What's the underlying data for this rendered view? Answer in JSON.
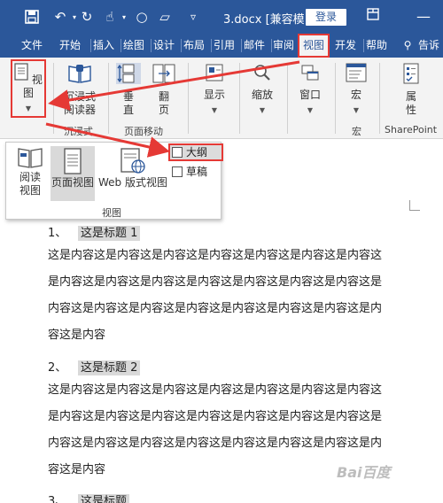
{
  "titlebar": {
    "doc_title": "3.docx [兼容模...",
    "login": "登录"
  },
  "tabs": [
    "文件",
    "开始",
    "插入",
    "绘图",
    "设计",
    "布局",
    "引用",
    "邮件",
    "审阅",
    "视图",
    "开发",
    "帮助",
    "告诉"
  ],
  "ribbon": {
    "view_btn": "视图",
    "immersive_btn_line1": "沉浸式",
    "immersive_btn_line2": "阅读器",
    "immersive_group": "沉浸式",
    "vertical_btn": "垂直",
    "flip_btn": "翻页",
    "page_move_group": "页面移动",
    "show_btn": "显示",
    "zoom_btn": "缩放",
    "window_btn": "窗口",
    "macro_btn": "宏",
    "macro_group": "宏",
    "props_btn": "属性",
    "sharepoint_group": "SharePoint"
  },
  "panel": {
    "read_line1": "阅读",
    "read_line2": "视图",
    "page_view": "页面视图",
    "web_view": "Web 版式视图",
    "label": "视图",
    "outline": "大纲",
    "draft": "草稿"
  },
  "document": {
    "h1_num": "1、",
    "h1_text": "这是标题 1",
    "p1_lines": [
      "这是内容这是内容这是内容这是内容这是内容这是内容这是内容这",
      "是内容这是内容这是内容这是内容这是内容这是内容这是内容这是",
      "内容这是内容这是内容这是内容这是内容这是内容这是内容这是内",
      "容这是内容"
    ],
    "h2_num": "2、",
    "h2_text": "这是标题 2",
    "p2_lines": [
      "这是内容这是内容这是内容这是内容这是内容这是内容这是内容这",
      "是内容这是内容这是内容这是内容这是内容这是内容这是内容这是",
      "内容这是内容这是内容这是内容这是内容这是内容这是内容这是内",
      "容这是内容"
    ],
    "h3_num": "3、",
    "h3_text": "这是标题"
  },
  "colors": {
    "word_blue": "#2b579a",
    "highlight_red": "#e53935"
  }
}
